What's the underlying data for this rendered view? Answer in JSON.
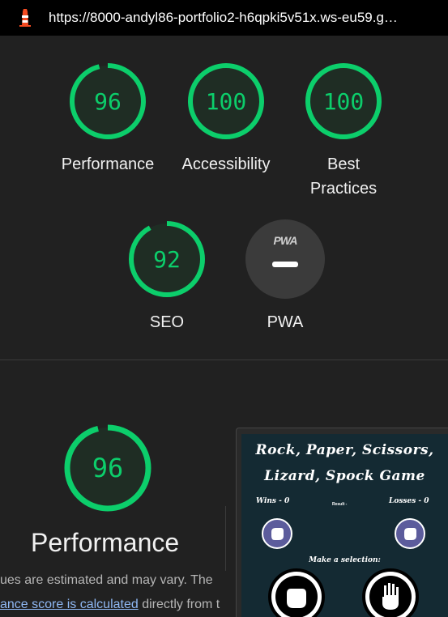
{
  "browser": {
    "url": "https://8000-andyl86-portfolio2-h6qpki5v51x.ws-eu59.g…",
    "favicon": "lighthouse-icon"
  },
  "colors": {
    "pass": "#0cce6b",
    "background": "#212121",
    "link": "#8fb8f4"
  },
  "scores": [
    {
      "label": "Performance",
      "value": "96",
      "fraction": 0.96
    },
    {
      "label": "Accessibility",
      "value": "100",
      "fraction": 1.0
    },
    {
      "label": "Best Practices",
      "value": "100",
      "fraction": 1.0
    },
    {
      "label": "SEO",
      "value": "92",
      "fraction": 0.92
    }
  ],
  "pwa": {
    "badge": "PWA",
    "label": "PWA"
  },
  "performance_section": {
    "score": "96",
    "fraction": 0.96,
    "title": "Performance",
    "desc_line1": "ues are estimated and may vary. The",
    "desc_link": "ance score is calculated",
    "desc_line2_rest": " directly from t"
  },
  "screenshot": {
    "title_line1": "Rock, Paper, Scissors,",
    "title_line2": "Lizard, Spock Game",
    "wins": "Wins - 0",
    "result": "Result -",
    "losses": "Losses - 0",
    "make_selection": "Make a selection:"
  }
}
